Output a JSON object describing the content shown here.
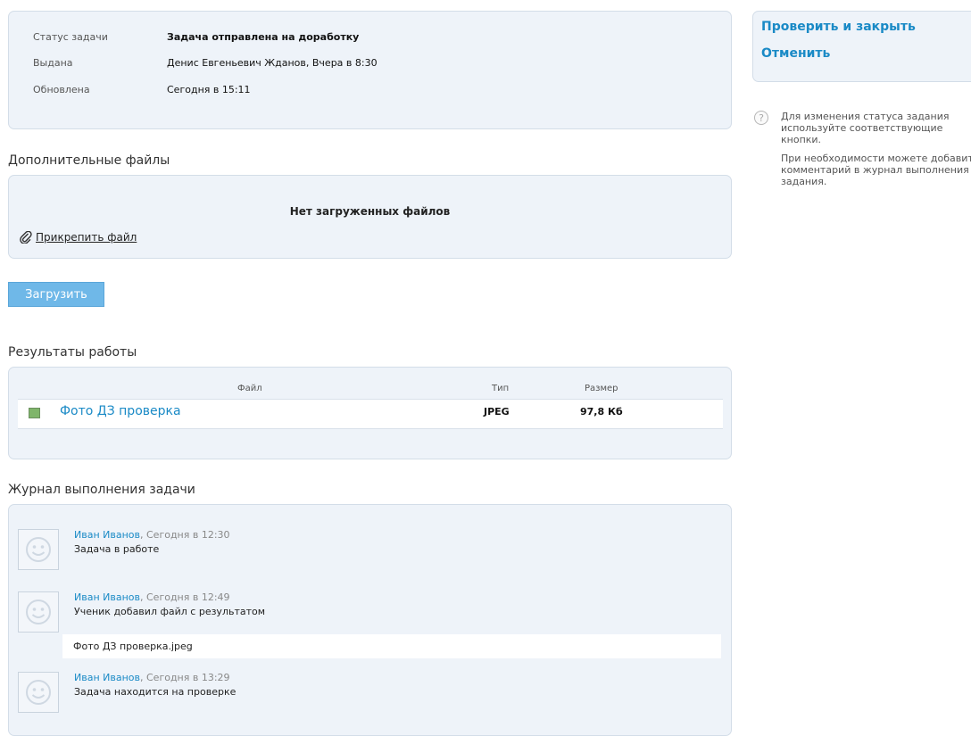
{
  "status": {
    "rows": [
      {
        "label": "Статус задачи",
        "value": "Задача отправлена на доработку"
      },
      {
        "label": "Выдана",
        "value": "Денис Евгеньевич Жданов, Вчера в 8:30"
      },
      {
        "label": "Обновлена",
        "value": "Сегодня в 15:11"
      }
    ]
  },
  "files": {
    "title": "Дополнительные файлы",
    "empty_text": "Нет загруженных файлов",
    "attach_label": "Прикрепить файл"
  },
  "upload_button": "Загрузить",
  "results": {
    "title": "Результаты работы",
    "headers": {
      "file": "Файл",
      "type": "Тип",
      "size": "Размер"
    },
    "rows": [
      {
        "file": "Фото ДЗ проверка",
        "type": "JPEG",
        "size": "97,8 Кб"
      }
    ]
  },
  "log": {
    "title": "Журнал выполнения задачи",
    "entries": [
      {
        "author": "Иван Иванов",
        "time": ", Сегодня в 12:30",
        "message": "Задача в работе"
      },
      {
        "author": "Иван Иванов",
        "time": ", Сегодня в 12:49",
        "message": "Ученик добавил файл с результатом",
        "attachment": "Фото ДЗ проверка.jpeg"
      },
      {
        "author": "Иван Иванов",
        "time": ", Сегодня в 13:29",
        "message": "Задача находится на проверке"
      }
    ]
  },
  "actions": {
    "check_close": "Проверить и закрыть",
    "cancel": "Отменить"
  },
  "help": {
    "icon": "question-icon",
    "text1": "Для изменения статуса задания используйте соответствующие кнопки.",
    "text2": "При необходимости можете добавить комментарий в журнал выполнения задания."
  },
  "colors": {
    "accent": "#1a8ac6",
    "panel_bg": "#eef3f9",
    "button_bg": "#6fb8e8"
  }
}
